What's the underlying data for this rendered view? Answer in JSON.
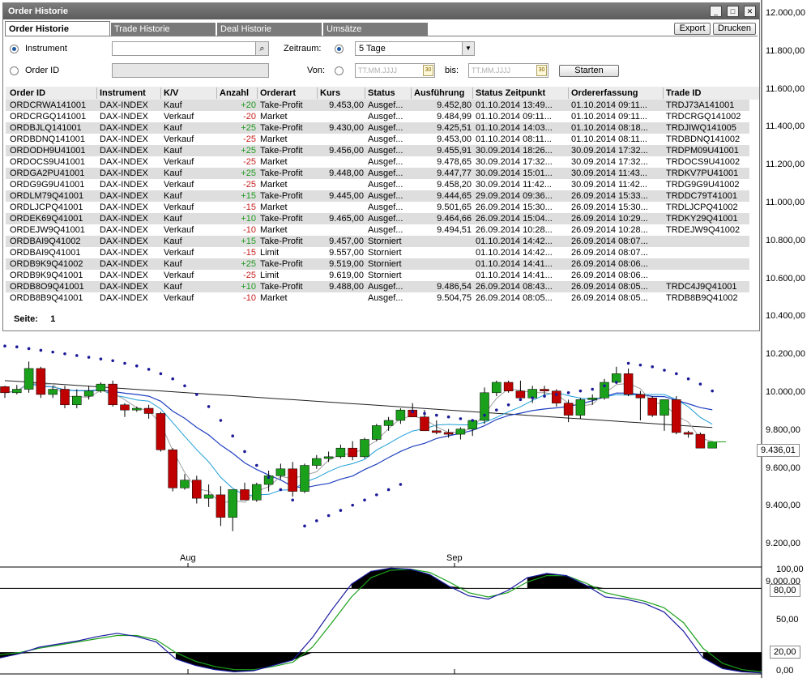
{
  "window": {
    "title": "Order Historie",
    "controls": [
      "_",
      "□",
      "✕"
    ]
  },
  "tabs": [
    "Order Historie",
    "Trade Historie",
    "Deal Historie",
    "Umsätze"
  ],
  "buttons": {
    "export": "Export",
    "print": "Drucken",
    "start": "Starten"
  },
  "filters": {
    "instrument_label": "Instrument",
    "order_id_label": "Order ID",
    "zeitraum_label": "Zeitraum:",
    "zeitraum_value": "5 Tage",
    "von_label": "Von:",
    "bis_label": "bis:",
    "date_placeholder": "TT.MM.JJJJ",
    "calendar_glyph": "30"
  },
  "table": {
    "columns": [
      "Order ID",
      "Instrument",
      "K/V",
      "Anzahl",
      "Orderart",
      "Kurs",
      "Status",
      "Ausführung",
      "Status Zeitpunkt",
      "Ordererfassung",
      "Trade ID"
    ],
    "rows": [
      [
        "ORDCRWA141001",
        "DAX-INDEX",
        "Kauf",
        "+20",
        "Take-Profit",
        "9.453,00",
        "Ausgef...",
        "9.452,80",
        "01.10.2014 13:49...",
        "01.10.2014 09:11...",
        "TRDJ73A141001"
      ],
      [
        "ORDCRGQ141001",
        "DAX-INDEX",
        "Verkauf",
        "-20",
        "Market",
        "",
        "Ausgef...",
        "9.484,99",
        "01.10.2014 09:11...",
        "01.10.2014 09:11...",
        "TRDCRGQ141002"
      ],
      [
        "ORDBJLQ141001",
        "DAX-INDEX",
        "Kauf",
        "+25",
        "Take-Profit",
        "9.430,00",
        "Ausgef...",
        "9.425,51",
        "01.10.2014 14:03...",
        "01.10.2014 08:18...",
        "TRDJIWQ141005"
      ],
      [
        "ORDBDNQ141001",
        "DAX-INDEX",
        "Verkauf",
        "-25",
        "Market",
        "",
        "Ausgef...",
        "9.453,00",
        "01.10.2014 08:11...",
        "01.10.2014 08:11...",
        "TRDBDNQ141002"
      ],
      [
        "ORDODH9U41001",
        "DAX-INDEX",
        "Kauf",
        "+25",
        "Take-Profit",
        "9.456,00",
        "Ausgef...",
        "9.455,91",
        "30.09.2014 18:26...",
        "30.09.2014 17:32...",
        "TRDPM09U41001"
      ],
      [
        "ORDOCS9U41001",
        "DAX-INDEX",
        "Verkauf",
        "-25",
        "Market",
        "",
        "Ausgef...",
        "9.478,65",
        "30.09.2014 17:32...",
        "30.09.2014 17:32...",
        "TRDOCS9U41002"
      ],
      [
        "ORDGA2PU41001",
        "DAX-INDEX",
        "Kauf",
        "+25",
        "Take-Profit",
        "9.448,00",
        "Ausgef...",
        "9.447,77",
        "30.09.2014 15:01...",
        "30.09.2014 11:43...",
        "TRDKV7PU41001"
      ],
      [
        "ORDG9G9U41001",
        "DAX-INDEX",
        "Verkauf",
        "-25",
        "Market",
        "",
        "Ausgef...",
        "9.458,20",
        "30.09.2014 11:42...",
        "30.09.2014 11:42...",
        "TRDG9G9U41002"
      ],
      [
        "ORDLM79Q41001",
        "DAX-INDEX",
        "Kauf",
        "+15",
        "Take-Profit",
        "9.445,00",
        "Ausgef...",
        "9.444,65",
        "29.09.2014 09:36...",
        "26.09.2014 15:33...",
        "TRDDC79T41001"
      ],
      [
        "ORDLJCPQ41001",
        "DAX-INDEX",
        "Verkauf",
        "-15",
        "Market",
        "",
        "Ausgef...",
        "9.501,65",
        "26.09.2014 15:30...",
        "26.09.2014 15:30...",
        "TRDLJCPQ41002"
      ],
      [
        "ORDEK69Q41001",
        "DAX-INDEX",
        "Kauf",
        "+10",
        "Take-Profit",
        "9.465,00",
        "Ausgef...",
        "9.464,66",
        "26.09.2014 15:04...",
        "26.09.2014 10:29...",
        "TRDKY29Q41001"
      ],
      [
        "ORDEJW9Q41001",
        "DAX-INDEX",
        "Verkauf",
        "-10",
        "Market",
        "",
        "Ausgef...",
        "9.494,51",
        "26.09.2014 10:28...",
        "26.09.2014 10:28...",
        "TRDEJW9Q41002"
      ],
      [
        "ORDBAI9Q41002",
        "DAX-INDEX",
        "Kauf",
        "+15",
        "Take-Profit",
        "9.457,00",
        "Storniert",
        "",
        "01.10.2014 14:42...",
        "26.09.2014 08:07...",
        ""
      ],
      [
        "ORDBAI9Q41001",
        "DAX-INDEX",
        "Verkauf",
        "-15",
        "Limit",
        "9.557,00",
        "Storniert",
        "",
        "01.10.2014 14:42...",
        "26.09.2014 08:07...",
        ""
      ],
      [
        "ORDB9K9Q41002",
        "DAX-INDEX",
        "Kauf",
        "+25",
        "Take-Profit",
        "9.519,00",
        "Storniert",
        "",
        "01.10.2014 14:41...",
        "26.09.2014 08:06...",
        ""
      ],
      [
        "ORDB9K9Q41001",
        "DAX-INDEX",
        "Verkauf",
        "-25",
        "Limit",
        "9.619,00",
        "Storniert",
        "",
        "01.10.2014 14:41...",
        "26.09.2014 08:06...",
        ""
      ],
      [
        "ORDB8O9Q41001",
        "DAX-INDEX",
        "Kauf",
        "+10",
        "Take-Profit",
        "9.488,00",
        "Ausgef...",
        "9.486,54",
        "26.09.2014 08:43...",
        "26.09.2014 08:05...",
        "TRDC4J9Q41001"
      ],
      [
        "ORDB8B9Q41001",
        "DAX-INDEX",
        "Verkauf",
        "-10",
        "Market",
        "",
        "Ausgef...",
        "9.504,75",
        "26.09.2014 08:05...",
        "26.09.2014 08:05...",
        "TRDB8B9Q41002"
      ]
    ]
  },
  "pager": {
    "label": "Seite:",
    "page": "1"
  },
  "chart": {
    "price_labels": [
      "12.000,00",
      "11.800,00",
      "11.600,00",
      "11.400,00",
      "11.200,00",
      "11.000,00",
      "10.800,00",
      "10.600,00",
      "10.400,00",
      "10.200,00",
      "10.000,00",
      "9.800,00",
      "9.600,00",
      "9.400,00",
      "9.200,00",
      "9.000,00"
    ],
    "current_price": "9.436,01",
    "month_labels": [
      "Aug",
      "Sep"
    ],
    "stoch_labels": [
      "100,00",
      "80,00",
      "50,00",
      "20,00",
      "0,00"
    ],
    "colors": {
      "up": "#1aa01a",
      "down": "#c00000",
      "sma_fast": "#a0a0a0",
      "sma_mid": "#1e9ed8",
      "sma_slow": "#2040c0",
      "sma_long": "#202020",
      "sar": "#1a1a9a",
      "stoch_k": "#1a1aa0",
      "stoch_d": "#1aa01a"
    }
  },
  "chart_data": {
    "type": "candlestick",
    "instrument": "DAX-INDEX",
    "ylim": [
      8900,
      10000
    ],
    "stoch_ylim": [
      0,
      100
    ],
    "candles": [
      [
        9755,
        9760,
        9690,
        9720
      ],
      [
        9720,
        9765,
        9710,
        9740
      ],
      [
        9740,
        9900,
        9720,
        9860
      ],
      [
        9860,
        9870,
        9690,
        9710
      ],
      [
        9710,
        9760,
        9690,
        9740
      ],
      [
        9740,
        9760,
        9630,
        9650
      ],
      [
        9650,
        9740,
        9630,
        9700
      ],
      [
        9700,
        9760,
        9680,
        9730
      ],
      [
        9730,
        9780,
        9720,
        9770
      ],
      [
        9770,
        9790,
        9640,
        9650
      ],
      [
        9650,
        9660,
        9580,
        9620
      ],
      [
        9620,
        9640,
        9610,
        9630
      ],
      [
        9630,
        9650,
        9570,
        9600
      ],
      [
        9600,
        9610,
        9380,
        9390
      ],
      [
        9390,
        9400,
        9150,
        9170
      ],
      [
        9170,
        9250,
        9160,
        9215
      ],
      [
        9215,
        9240,
        9080,
        9110
      ],
      [
        9110,
        9190,
        9060,
        9130
      ],
      [
        9130,
        9180,
        8950,
        9000
      ],
      [
        9000,
        9160,
        8920,
        9160
      ],
      [
        9160,
        9200,
        9110,
        9100
      ],
      [
        9100,
        9200,
        9090,
        9190
      ],
      [
        9190,
        9270,
        9150,
        9240
      ],
      [
        9240,
        9310,
        9220,
        9280
      ],
      [
        9280,
        9320,
        9120,
        9150
      ],
      [
        9150,
        9310,
        9140,
        9300
      ],
      [
        9300,
        9360,
        9280,
        9340
      ],
      [
        9340,
        9380,
        9320,
        9350
      ],
      [
        9350,
        9420,
        9340,
        9400
      ],
      [
        9400,
        9440,
        9330,
        9350
      ],
      [
        9350,
        9460,
        9340,
        9450
      ],
      [
        9450,
        9540,
        9440,
        9530
      ],
      [
        9530,
        9580,
        9500,
        9560
      ],
      [
        9560,
        9630,
        9540,
        9620
      ],
      [
        9620,
        9660,
        9590,
        9580
      ],
      [
        9580,
        9620,
        9500,
        9500
      ],
      [
        9500,
        9560,
        9480,
        9490
      ],
      [
        9490,
        9510,
        9460,
        9480
      ],
      [
        9480,
        9520,
        9450,
        9510
      ],
      [
        9510,
        9560,
        9470,
        9560
      ],
      [
        9560,
        9750,
        9540,
        9720
      ],
      [
        9720,
        9790,
        9700,
        9780
      ],
      [
        9780,
        9790,
        9720,
        9730
      ],
      [
        9730,
        9790,
        9700,
        9690
      ],
      [
        9690,
        9760,
        9660,
        9740
      ],
      [
        9740,
        9760,
        9700,
        9730
      ],
      [
        9730,
        9740,
        9640,
        9660
      ],
      [
        9660,
        9680,
        9550,
        9590
      ],
      [
        9590,
        9690,
        9570,
        9680
      ],
      [
        9680,
        9710,
        9650,
        9690
      ],
      [
        9690,
        9800,
        9680,
        9780
      ],
      [
        9780,
        9870,
        9770,
        9830
      ],
      [
        9830,
        9860,
        9700,
        9710
      ],
      [
        9710,
        9730,
        9560,
        9690
      ],
      [
        9690,
        9700,
        9580,
        9590
      ],
      [
        9590,
        9640,
        9500,
        9680
      ],
      [
        9680,
        9700,
        9480,
        9490
      ],
      [
        9490,
        9500,
        9460,
        9480
      ],
      [
        9480,
        9490,
        9400,
        9400
      ],
      [
        9400,
        9440,
        9410,
        9436
      ]
    ],
    "stochastic_k": [
      15,
      19,
      25,
      28,
      31,
      35,
      38,
      35,
      30,
      14,
      8,
      4,
      2,
      3,
      8,
      13,
      34,
      60,
      84,
      96,
      99,
      98,
      93,
      82,
      73,
      70,
      78,
      90,
      94,
      92,
      83,
      72,
      70,
      66,
      58,
      40,
      15,
      5,
      2,
      1
    ],
    "stochastic_d": [
      18,
      20,
      24,
      27,
      30,
      33,
      36,
      36,
      32,
      20,
      12,
      7,
      4,
      4,
      7,
      11,
      25,
      48,
      72,
      90,
      97,
      98,
      95,
      86,
      76,
      72,
      76,
      86,
      92,
      92,
      85,
      76,
      72,
      68,
      62,
      48,
      24,
      10,
      4,
      2
    ]
  }
}
